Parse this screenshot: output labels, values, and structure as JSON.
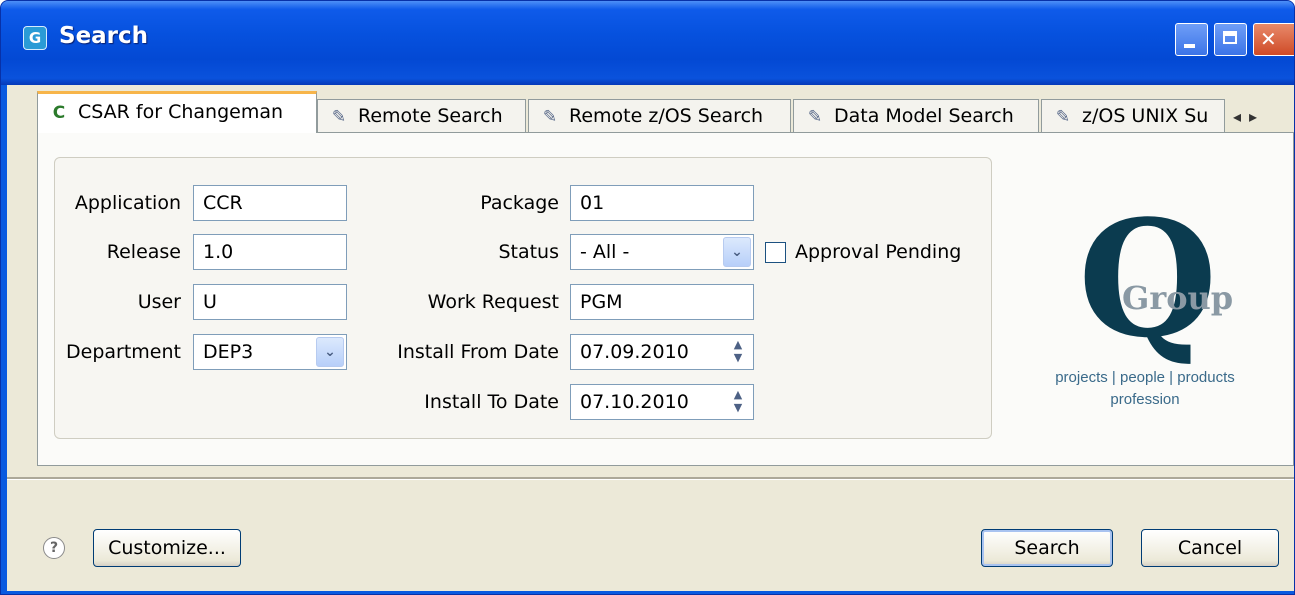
{
  "window": {
    "title": "Search",
    "icon": "app-icon"
  },
  "tabs": [
    {
      "label": "CSAR for Changeman",
      "icon": "csar-icon",
      "glyph": "C",
      "active": true
    },
    {
      "label": "Remote Search",
      "icon": "remote-search-icon",
      "glyph": "✎",
      "active": false
    },
    {
      "label": "Remote z/OS Search",
      "icon": "remote-zos-search-icon",
      "glyph": "✎",
      "active": false
    },
    {
      "label": "Data Model Search",
      "icon": "data-model-search-icon",
      "glyph": "✎",
      "active": false
    },
    {
      "label": "z/OS UNIX Su",
      "icon": "zos-unix-search-icon",
      "glyph": "✎",
      "active": false
    }
  ],
  "tab_scroll": {
    "left": "◂",
    "right": "▸"
  },
  "form": {
    "application": {
      "label": "Application",
      "value": "CCR"
    },
    "release": {
      "label": "Release",
      "value": "1.0"
    },
    "user": {
      "label": "User",
      "value": "U"
    },
    "department": {
      "label": "Department",
      "value": "DEP3"
    },
    "package": {
      "label": "Package",
      "value": "01"
    },
    "status": {
      "label": "Status",
      "value": "- All -"
    },
    "approval_pending": {
      "label": "Approval Pending",
      "checked": false
    },
    "work_request": {
      "label": "Work Request",
      "value": "PGM"
    },
    "install_from_date": {
      "label": "Install From Date",
      "value": "07.09.2010"
    },
    "install_to_date": {
      "label": "Install To Date",
      "value": "07.10.2010"
    }
  },
  "logo": {
    "letter": "Q",
    "word": "Group",
    "tagline_1": "projects | people | products",
    "tagline_2": "profession"
  },
  "footer": {
    "help": "?",
    "customize": "Customize...",
    "search": "Search",
    "cancel": "Cancel"
  },
  "colors": {
    "title_bar": "#0651de",
    "dialog_bg": "#ece9d8",
    "active_tab_accent": "#f7b54a",
    "logo_navy": "#0b3b4f"
  }
}
